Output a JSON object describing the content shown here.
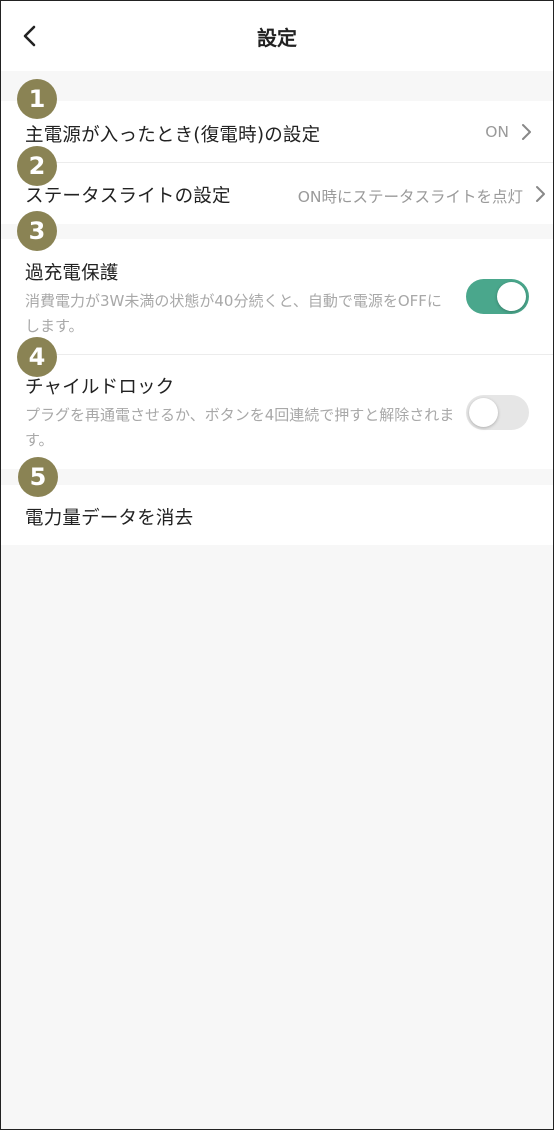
{
  "header": {
    "title": "設定",
    "back_icon": "chevron-left-icon"
  },
  "settings": {
    "power_restore": {
      "title": "主電源が入ったとき(復電時)の設定",
      "value": "ON"
    },
    "status_light": {
      "title": "ステータスライトの設定",
      "value": "ON時にステータスライトを点灯"
    },
    "overcharge": {
      "title": "過充電保護",
      "description": "消費電力が3W未満の状態が40分続くと、自動で電源をOFFにします。",
      "enabled": true
    },
    "child_lock": {
      "title": "チャイルドロック",
      "description": "プラグを再通電させるか、ボタンを4回連続で押すと解除されます。",
      "enabled": false
    },
    "clear_data": {
      "title": "電力量データを消去"
    }
  },
  "badges": [
    "1",
    "2",
    "3",
    "4",
    "5"
  ],
  "colors": {
    "toggle_on": "#4aa78c",
    "toggle_off": "#e6e6e6",
    "badge": "#8a8354",
    "background": "#f7f7f7"
  }
}
